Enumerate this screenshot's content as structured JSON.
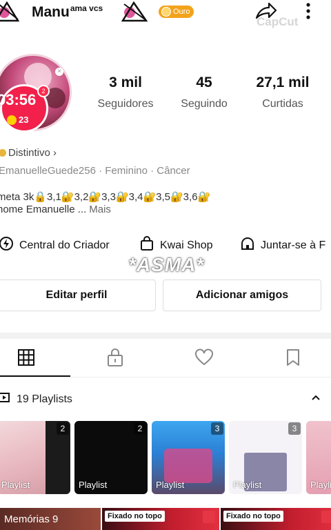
{
  "header": {
    "name": "Manu",
    "name_sup": "ama vcs",
    "badge": "Ouro",
    "watermark": "CapCut"
  },
  "avatar": {
    "timer": "03:56",
    "coins": "23",
    "notification": "2"
  },
  "stats": [
    {
      "value": "3 mil",
      "label": "Seguidores"
    },
    {
      "value": "45",
      "label": "Seguindo"
    },
    {
      "value": "27,1 mil",
      "label": "Curtidas"
    }
  ],
  "profile": {
    "distintivo": "Distintivo ›",
    "info_line": "EmanuelleGuede256 · Feminino · Câncer",
    "bio_line1": "meta 3k🔒3,1🔐3,2🔐3,3🔐3,4🔐3,5🔐3,6🔐",
    "bio_line2": "nome Emanuelle ...",
    "bio_more": "Mais"
  },
  "shortcuts": {
    "creator": "Central do Criador",
    "shop": "Kwai Shop",
    "join": "Juntar-se à F"
  },
  "overlay_text": "*ASMA*",
  "buttons": {
    "edit": "Editar perfil",
    "add": "Adicionar amigos"
  },
  "playlists": {
    "header": "19 Playlists",
    "cards": [
      {
        "label": "Playlist",
        "count": "2"
      },
      {
        "label": "Playlist",
        "count": "2"
      },
      {
        "label": "Playlist",
        "count": "3"
      },
      {
        "label": "Playlist",
        "count": "3"
      },
      {
        "label": "Playli",
        "count": ""
      }
    ]
  },
  "bottom": {
    "memories": "Memórias 9",
    "pinned1": "Fixado no topo",
    "pinned2": "Fixado no topo"
  }
}
